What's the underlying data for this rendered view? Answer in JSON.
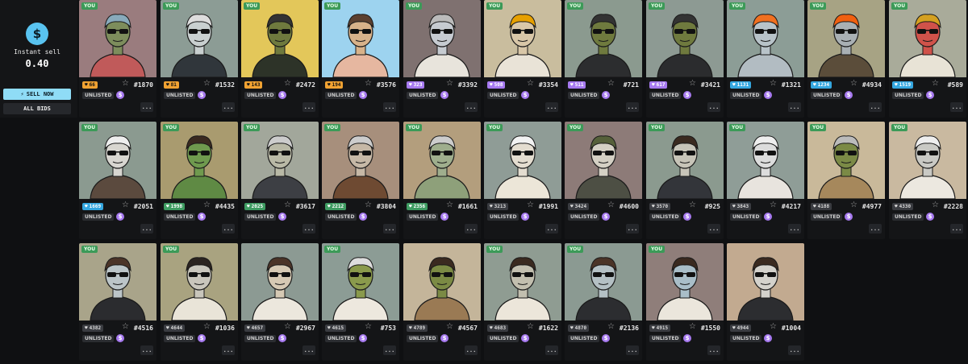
{
  "sidebar": {
    "instant_sell_label": "Instant sell",
    "instant_sell_price": "0.40",
    "sell_icon": "dollar-icon",
    "sell_now_label": "SELL NOW",
    "sell_now_icon": "lightning-icon",
    "all_bids_label": "ALL BIDS"
  },
  "card_common": {
    "owner_badge": "YOU",
    "status_label": "UNLISTED",
    "more_label": "...",
    "coin_icon": "$",
    "star_icon": "☆"
  },
  "colors": {
    "accent_blue": "#8fdcf6",
    "you_badge": "#3c9a58",
    "rank_orange": "#f0a232",
    "rank_purple": "#a67af0",
    "rank_blue": "#35a7e0",
    "rank_green": "#3f9c62",
    "rank_gray": "#3a3c41"
  },
  "cards": [
    {
      "rank": "66",
      "rank_tier": "orange",
      "rank_icon": "heart-icon",
      "number": "1870",
      "bg": "#9a7c7e",
      "you": true
    },
    {
      "rank": "81",
      "rank_tier": "orange",
      "rank_icon": "heart-icon",
      "number": "1532",
      "bg": "#8c9c95",
      "you": true
    },
    {
      "rank": "143",
      "rank_tier": "orange",
      "rank_icon": "heart-icon",
      "number": "2472",
      "bg": "#e3c75a",
      "you": true
    },
    {
      "rank": "194",
      "rank_tier": "orange",
      "rank_icon": "heart-icon",
      "number": "3576",
      "bg": "#9dd3ef",
      "you": true
    },
    {
      "rank": "323",
      "rank_tier": "purple",
      "rank_icon": "heart-icon",
      "number": "3392",
      "bg": "#7f7170",
      "you": true
    },
    {
      "rank": "508",
      "rank_tier": "purple",
      "rank_icon": "heart-icon",
      "number": "3354",
      "bg": "#c9bd9e",
      "you": true
    },
    {
      "rank": "511",
      "rank_tier": "purple",
      "rank_icon": "heart-icon",
      "number": "721",
      "bg": "#8b9a8f",
      "you": true
    },
    {
      "rank": "617",
      "rank_tier": "purple",
      "rank_icon": "heart-icon",
      "number": "3421",
      "bg": "#8d9a93",
      "you": true
    },
    {
      "rank": "1131",
      "rank_tier": "blue",
      "rank_icon": "heart-icon",
      "number": "1321",
      "bg": "#8c9d96",
      "you": true
    },
    {
      "rank": "1234",
      "rank_tier": "blue",
      "rank_icon": "heart-icon",
      "number": "4934",
      "bg": "#a7a384",
      "you": true
    },
    {
      "rank": "1519",
      "rank_tier": "blue",
      "rank_icon": "heart-icon",
      "number": "589",
      "bg": "#a9ab9a",
      "you": true
    },
    {
      "rank": "1669",
      "rank_tier": "blue",
      "rank_icon": "heart-icon",
      "number": "2051",
      "bg": "#8b9a90",
      "you": true
    },
    {
      "rank": "1998",
      "rank_tier": "green",
      "rank_icon": "heart-icon",
      "number": "4435",
      "bg": "#a99b6f",
      "you": true
    },
    {
      "rank": "2025",
      "rank_tier": "green",
      "rank_icon": "heart-icon",
      "number": "3617",
      "bg": "#a2a79b",
      "you": true
    },
    {
      "rank": "2212",
      "rank_tier": "green",
      "rank_icon": "heart-icon",
      "number": "3804",
      "bg": "#a78f7c",
      "you": true
    },
    {
      "rank": "2356",
      "rank_tier": "green",
      "rank_icon": "heart-icon",
      "number": "1661",
      "bg": "#b39e7d",
      "you": true
    },
    {
      "rank": "3213",
      "rank_tier": "gray",
      "rank_icon": "heart-icon",
      "number": "1991",
      "bg": "#8f9c96",
      "you": true
    },
    {
      "rank": "3424",
      "rank_tier": "gray",
      "rank_icon": "heart-icon",
      "number": "4600",
      "bg": "#8d7b78",
      "you": true
    },
    {
      "rank": "3570",
      "rank_tier": "gray",
      "rank_icon": "heart-icon",
      "number": "925",
      "bg": "#8b9a8f",
      "you": true
    },
    {
      "rank": "3843",
      "rank_tier": "gray",
      "rank_icon": "heart-icon",
      "number": "4217",
      "bg": "#8f9d97",
      "you": true
    },
    {
      "rank": "4188",
      "rank_tier": "gray",
      "rank_icon": "heart-icon",
      "number": "4977",
      "bg": "#c9b99a",
      "you": true
    },
    {
      "rank": "4330",
      "rank_tier": "gray",
      "rank_icon": "heart-icon",
      "number": "2228",
      "bg": "#c9b9a0",
      "you": true
    },
    {
      "rank": "4382",
      "rank_tier": "gray",
      "rank_icon": "heart-icon",
      "number": "4516",
      "bg": "#a9a48a",
      "you": true
    },
    {
      "rank": "4644",
      "rank_tier": "gray",
      "rank_icon": "heart-icon",
      "number": "1036",
      "bg": "#a9a380",
      "you": true
    },
    {
      "rank": "4657",
      "rank_tier": "gray",
      "rank_icon": "heart-icon",
      "number": "2967",
      "bg": "#8c9a93",
      "you": false
    },
    {
      "rank": "4615",
      "rank_tier": "gray",
      "rank_icon": "heart-icon",
      "number": "753",
      "bg": "#8c9c95",
      "you": true
    },
    {
      "rank": "4789",
      "rank_tier": "gray",
      "rank_icon": "heart-icon",
      "number": "4567",
      "bg": "#c4b59a",
      "you": false
    },
    {
      "rank": "4683",
      "rank_tier": "gray",
      "rank_icon": "heart-icon",
      "number": "1622",
      "bg": "#8f9c92",
      "you": true
    },
    {
      "rank": "4870",
      "rank_tier": "gray",
      "rank_icon": "heart-icon",
      "number": "2136",
      "bg": "#8b9a92",
      "you": true
    },
    {
      "rank": "4915",
      "rank_tier": "gray",
      "rank_icon": "heart-icon",
      "number": "1550",
      "bg": "#8f7e7a",
      "you": true
    },
    {
      "rank": "4944",
      "rank_tier": "gray",
      "rank_icon": "heart-icon",
      "number": "1004",
      "bg": "#c2aa90",
      "you": false
    }
  ]
}
